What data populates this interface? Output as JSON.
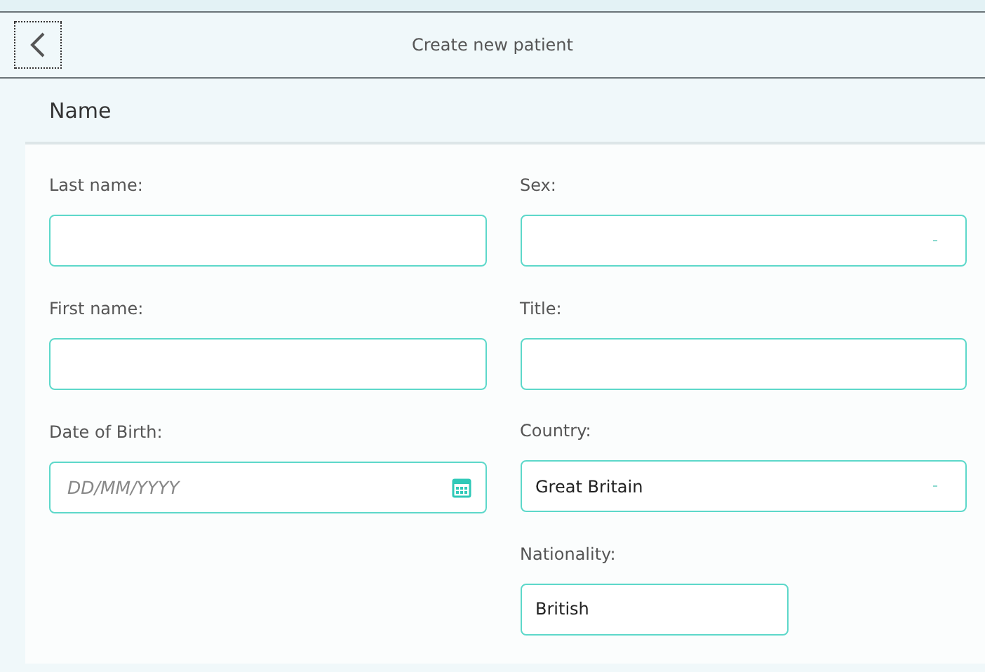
{
  "header": {
    "title": "Create new patient"
  },
  "section": {
    "title": "Name"
  },
  "left_fields": [
    {
      "label": "Last name:",
      "kind": "text"
    },
    {
      "label": "First name:",
      "kind": "text"
    },
    {
      "label": "Date of Birth:",
      "kind": "date",
      "placeholder": "DD/MM/YYYY"
    }
  ],
  "right_fields": [
    {
      "label": "Sex:",
      "kind": "select"
    },
    {
      "label": "Title:",
      "kind": "text"
    },
    {
      "label": "Country:",
      "kind": "select",
      "value": "Great Britain"
    },
    {
      "label": "Nationality:",
      "kind": "short",
      "value": "British"
    }
  ]
}
